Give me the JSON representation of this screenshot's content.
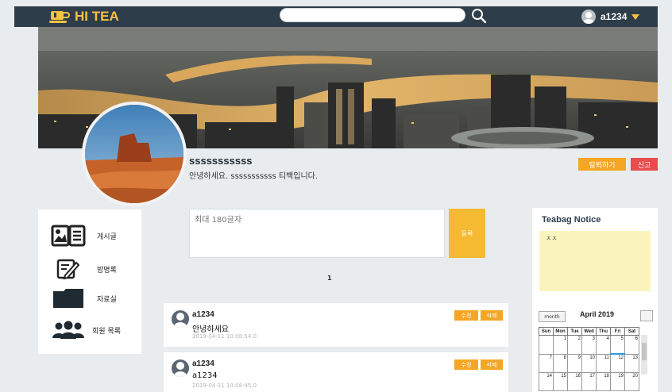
{
  "header": {
    "logo_text": "HI TEA",
    "search_placeholder": "",
    "username": "a1234",
    "brand_color": "#f5c242",
    "bar_color": "#2e3d4a"
  },
  "profile": {
    "name": "sssssssssss",
    "greeting": "안녕하세요. sssssssssss 티백입니다.",
    "withdraw_label": "탈퇴하기",
    "report_label": "신고"
  },
  "sidebar": {
    "items": [
      {
        "label": "게시글",
        "icon": "board-icon"
      },
      {
        "label": "방명록",
        "icon": "guestbook-icon"
      },
      {
        "label": "자료실",
        "icon": "folder-icon"
      },
      {
        "label": "회원 목록",
        "icon": "members-icon"
      }
    ]
  },
  "composer": {
    "placeholder": "최대 180글자",
    "submit_label": "등록"
  },
  "pagination": {
    "current": "1"
  },
  "posts": [
    {
      "author": "a1234",
      "body": "안녕하세요",
      "date": "2019-04-11 10:08:54.0",
      "edit_label": "수정",
      "delete_label": "삭제"
    },
    {
      "author": "a1234",
      "body": "a1234",
      "date": "2019-04-11 10:08:45.0",
      "edit_label": "수정",
      "delete_label": "삭제"
    }
  ],
  "notice": {
    "title": "Teabag Notice",
    "body": "ㅈㅈ"
  },
  "calendar": {
    "view_button": "month",
    "title": "April 2019",
    "weekdays": [
      "Sun",
      "Mon",
      "Tue",
      "Wed",
      "Thu",
      "Fri",
      "Sat"
    ],
    "weeks": [
      [
        "",
        "1",
        "2",
        "3",
        "4",
        "5",
        "6"
      ],
      [
        "7",
        "8",
        "9",
        "10",
        "11",
        "12",
        "13"
      ],
      [
        "14",
        "15",
        "16",
        "17",
        "18",
        "19",
        "20"
      ]
    ]
  }
}
